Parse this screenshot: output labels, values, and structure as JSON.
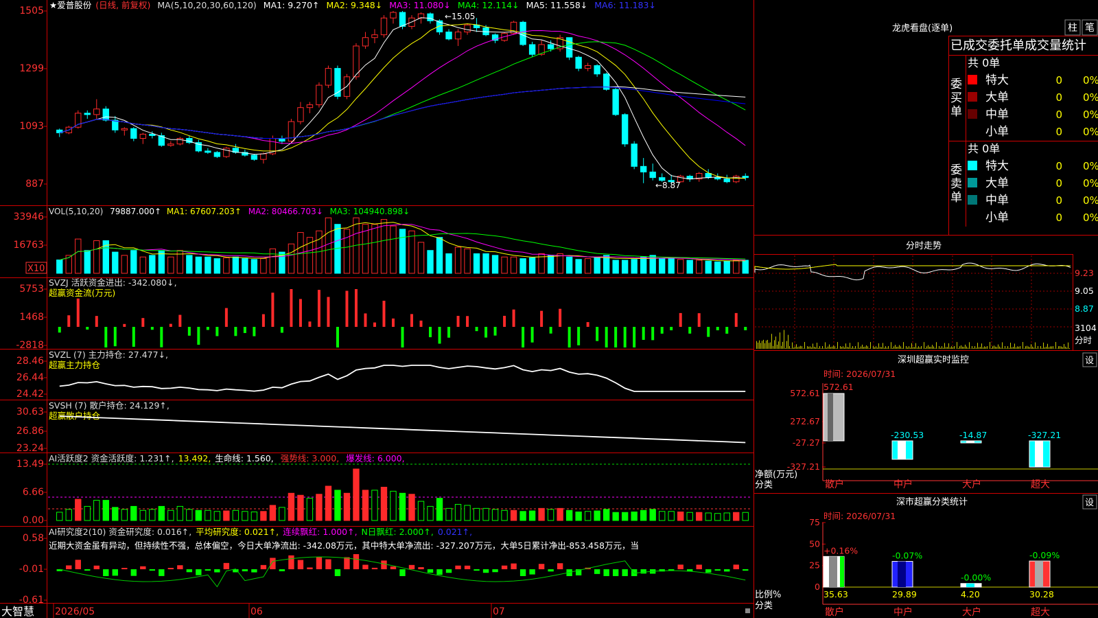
{
  "colors": {
    "up": "#ff2a2a",
    "down": "#00ffff",
    "grid": "#d00000",
    "bg": "#000000",
    "ma1": "#ffffff",
    "ma2": "#ffff00",
    "ma3": "#ff00ff",
    "ma4": "#00ff00",
    "ma5": "#ffffff",
    "ma6": "#0000ff",
    "label_red": "#ff3333",
    "label_yellow": "#ffff00"
  },
  "price_panel": {
    "stock_name": "★爱普股份",
    "period_note": "(日线, 前复权)",
    "ma_params": "MA(5,10,20,30,60,120)",
    "ma1": "MA1: 9.270↑",
    "ma2": "MA2: 9.348↓",
    "ma3": "MA3: 11.080↓",
    "ma4": "MA4: 12.114↓",
    "ma5": "MA5: 11.558↓",
    "ma6": "MA6: 11.183↓",
    "high_mark": "←15.05",
    "low_mark": "←8.87",
    "y_ticks": [
      "1505",
      "1299",
      "1093",
      "887"
    ]
  },
  "vol_panel": {
    "title": "VOL(5,10,20)",
    "value": "79887.000↑",
    "ma1": "MA1: 67607.203↑",
    "ma2": "MA2: 80466.703↓",
    "ma3": "MA3: 104940.898↓",
    "y_ticks": [
      "33946",
      "16763"
    ],
    "unit": "X10"
  },
  "svzj_panel": {
    "title": "SVZJ  活跃资金进出: -342.080↓,",
    "subtitle": "超赢资金流(万元)",
    "y_ticks": [
      "5753",
      "1468",
      "-2818"
    ]
  },
  "svzl_panel": {
    "title": "SVZL (7) 主力持仓: 27.477↓,",
    "subtitle": "超赢主力持仓",
    "y_ticks": [
      "28.46",
      "26.44",
      "24.42"
    ]
  },
  "svsh_panel": {
    "title": "SVSH (7) 散户持仓: 24.129↑,",
    "subtitle": "超赢散户持仓",
    "y_ticks": [
      "30.63",
      "26.86",
      "23.24"
    ]
  },
  "ai_panel": {
    "title": "AI活跃度2 资金活跃度: 1.231↑,",
    "v2": "13.492,",
    "v3": "生命线: 1.560,",
    "v4": "强势线: 3.000,",
    "v5": "爆发线: 6.000,",
    "y_ticks": [
      "13.49",
      "6.66",
      "0.00"
    ]
  },
  "research_panel": {
    "title": "AI研究度2(10) 资金研究度: 0.016↑,",
    "v2": "平均研究度: 0.021↑,",
    "v3": "连续飘红: 1.000↑,",
    "v4": "N日飘红: 2.000↑,",
    "v5": "0.021↑,",
    "comment": "近期大资金虽有异动，但持续性不强，总体偏空，今日大单净流出: -342.08万元，其中特大单净流出: -327.207万元，大单5日累计净出-853.458万元，当",
    "y_ticks": [
      "0.58",
      "-0.01",
      "-0.61"
    ]
  },
  "xaxis": {
    "brand": "大智慧",
    "labels": [
      "2026/05",
      "06",
      "07"
    ]
  },
  "right": {
    "lhb_title": "龙虎看盘(逐单)",
    "btn_bar": "柱",
    "btn_pen": "笔",
    "section_title": "已成交委托单成交量统计",
    "buy_label": "委买单",
    "sell_label": "委卖单",
    "buy_total": "共 0单",
    "sell_total": "共 0单",
    "buy_rows": [
      {
        "name": "特大",
        "count": "0",
        "pct": "0%",
        "color": "#ff0000"
      },
      {
        "name": "大单",
        "count": "0",
        "pct": "0%",
        "color": "#990000"
      },
      {
        "name": "中单",
        "count": "0",
        "pct": "0%",
        "color": "#660000"
      },
      {
        "name": "小单",
        "count": "0",
        "pct": "0%",
        "color": "#000000"
      }
    ],
    "sell_rows": [
      {
        "name": "特大",
        "count": "0",
        "pct": "0%",
        "color": "#00ffff"
      },
      {
        "name": "大单",
        "count": "0",
        "pct": "0%",
        "color": "#009999"
      },
      {
        "name": "中单",
        "count": "0",
        "pct": "0%",
        "color": "#007777"
      },
      {
        "name": "小单",
        "count": "0",
        "pct": "0%",
        "color": "#000000"
      }
    ],
    "fs_title": "分时走势",
    "fs_ticks": [
      "9.23",
      "9.05",
      "8.87",
      "3104",
      "分时"
    ],
    "sz_title": "深圳超赢实时监控",
    "sz_set": "设",
    "sz_time": "时间: 2026/07/31",
    "sz_ticks": [
      "572.61",
      "272.67",
      "-27.27",
      "-327.21"
    ],
    "sz_ylabel1": "净额(万元)",
    "sz_ylabel2": "分类",
    "sz_bars": [
      {
        "cat": "散户",
        "label": "572.61",
        "value": 572.61
      },
      {
        "cat": "中户",
        "label": "-230.53",
        "value": -230.53
      },
      {
        "cat": "大户",
        "label": "-14.87",
        "value": -14.87
      },
      {
        "cat": "超大",
        "label": "-327.21",
        "value": -327.21
      }
    ],
    "ss_title": "深市超赢分类统计",
    "ss_set": "设",
    "ss_time": "时间: 2026/07/31",
    "ss_ticks": [
      "75",
      "50",
      "25",
      "0"
    ],
    "ss_ylabel1": "比例%",
    "ss_ylabel2": "分类",
    "ss_bars": [
      {
        "cat": "散户",
        "top": "+0.16%",
        "bottom": "35.63",
        "value": 35.63,
        "color": "#ffffff"
      },
      {
        "cat": "中户",
        "top": "-0.07%",
        "bottom": "29.89",
        "value": 29.89,
        "color": "#2222ff"
      },
      {
        "cat": "大户",
        "top": "-0.00%",
        "bottom": "4.20",
        "value": 4.2,
        "color": "#ffffff"
      },
      {
        "cat": "超大",
        "top": "-0.09%",
        "bottom": "30.28",
        "value": 30.28,
        "color": "#ff3333"
      }
    ]
  },
  "chart_data": {
    "type": "candlestick",
    "note": "daily OHLC approximated from screenshot, y in price units; volume in X10 units",
    "price_range": [
      8.6,
      15.3
    ],
    "candles": [
      [
        10.8,
        10.85,
        10.55,
        10.7
      ],
      [
        10.7,
        10.95,
        10.65,
        10.9
      ],
      [
        10.9,
        11.5,
        10.85,
        11.4
      ],
      [
        11.4,
        11.5,
        11.2,
        11.35
      ],
      [
        11.35,
        11.9,
        11.2,
        11.55
      ],
      [
        11.55,
        11.65,
        11.1,
        11.15
      ],
      [
        11.15,
        11.3,
        10.7,
        10.8
      ],
      [
        10.8,
        10.9,
        10.6,
        10.85
      ],
      [
        10.85,
        10.9,
        10.4,
        10.5
      ],
      [
        10.5,
        10.7,
        10.3,
        10.65
      ],
      [
        10.65,
        10.75,
        10.5,
        10.6
      ],
      [
        10.6,
        10.7,
        10.2,
        10.25
      ],
      [
        10.25,
        10.4,
        10.2,
        10.3
      ],
      [
        10.3,
        10.55,
        10.25,
        10.5
      ],
      [
        10.5,
        10.6,
        10.3,
        10.35
      ],
      [
        10.35,
        10.45,
        10.0,
        10.05
      ],
      [
        10.05,
        10.15,
        9.95,
        10.0
      ],
      [
        10.0,
        10.05,
        9.8,
        9.85
      ],
      [
        9.85,
        10.2,
        9.8,
        10.15
      ],
      [
        10.15,
        10.3,
        9.95,
        10.0
      ],
      [
        10.0,
        10.1,
        9.85,
        9.9
      ],
      [
        9.9,
        9.95,
        9.7,
        9.75
      ],
      [
        9.75,
        10.0,
        9.6,
        9.95
      ],
      [
        9.95,
        10.6,
        9.9,
        10.5
      ],
      [
        10.5,
        10.6,
        10.3,
        10.4
      ],
      [
        10.4,
        11.2,
        10.35,
        11.1
      ],
      [
        11.1,
        11.8,
        11.0,
        11.6
      ],
      [
        11.6,
        11.8,
        11.4,
        11.7
      ],
      [
        11.7,
        12.5,
        11.6,
        12.4
      ],
      [
        12.4,
        13.1,
        12.3,
        13.0
      ],
      [
        13.0,
        13.1,
        11.9,
        12.0
      ],
      [
        12.0,
        12.8,
        11.9,
        12.7
      ],
      [
        12.7,
        13.9,
        12.6,
        13.8
      ],
      [
        13.8,
        14.3,
        13.7,
        14.1
      ],
      [
        14.1,
        14.4,
        13.9,
        14.2
      ],
      [
        14.2,
        14.9,
        14.1,
        14.8
      ],
      [
        14.8,
        15.05,
        14.6,
        15.0
      ],
      [
        15.0,
        15.05,
        14.4,
        14.5
      ],
      [
        14.5,
        14.9,
        14.4,
        14.8
      ],
      [
        14.8,
        15.0,
        14.6,
        14.95
      ],
      [
        14.95,
        15.0,
        14.6,
        14.7
      ],
      [
        14.7,
        14.75,
        14.2,
        14.3
      ],
      [
        14.3,
        14.4,
        14.0,
        14.05
      ],
      [
        14.05,
        14.4,
        13.8,
        14.3
      ],
      [
        14.3,
        14.6,
        14.2,
        14.55
      ],
      [
        14.55,
        14.8,
        14.3,
        14.45
      ],
      [
        14.45,
        14.55,
        14.15,
        14.2
      ],
      [
        14.2,
        14.25,
        13.9,
        14.0
      ],
      [
        14.0,
        14.3,
        13.95,
        14.25
      ],
      [
        14.25,
        14.7,
        14.2,
        14.65
      ],
      [
        14.65,
        14.7,
        13.8,
        13.85
      ],
      [
        13.85,
        13.95,
        13.4,
        13.5
      ],
      [
        13.5,
        14.0,
        13.45,
        13.85
      ],
      [
        13.85,
        14.0,
        13.6,
        13.7
      ],
      [
        13.7,
        14.2,
        13.6,
        14.1
      ],
      [
        14.1,
        14.1,
        13.3,
        13.4
      ],
      [
        13.4,
        13.45,
        12.9,
        13.0
      ],
      [
        13.0,
        13.2,
        12.9,
        13.1
      ],
      [
        13.1,
        13.15,
        12.7,
        12.8
      ],
      [
        12.8,
        12.85,
        12.2,
        12.25
      ],
      [
        12.25,
        12.3,
        11.3,
        11.35
      ],
      [
        11.35,
        11.4,
        10.2,
        10.3
      ],
      [
        10.3,
        10.4,
        9.4,
        9.5
      ],
      [
        9.5,
        9.8,
        8.9,
        9.3
      ],
      [
        9.3,
        9.6,
        9.0,
        9.1
      ],
      [
        9.1,
        9.25,
        8.95,
        9.0
      ],
      [
        9.0,
        9.2,
        8.87,
        8.95
      ],
      [
        8.95,
        9.2,
        8.92,
        9.15
      ],
      [
        9.15,
        9.2,
        8.95,
        9.05
      ],
      [
        9.05,
        9.3,
        8.95,
        9.25
      ],
      [
        9.25,
        9.4,
        9.05,
        9.1
      ],
      [
        9.1,
        9.25,
        9.0,
        9.05
      ],
      [
        9.05,
        9.2,
        8.9,
        8.95
      ],
      [
        8.95,
        9.2,
        8.9,
        9.15
      ],
      [
        9.15,
        9.25,
        9.0,
        9.1
      ]
    ],
    "volume": [
      8200,
      11000,
      21000,
      14000,
      20000,
      20000,
      13000,
      11000,
      14000,
      10000,
      11000,
      14000,
      10000,
      14000,
      11000,
      10000,
      10000,
      9000,
      9500,
      10000,
      9000,
      8500,
      9000,
      15000,
      13000,
      18000,
      25000,
      22000,
      26000,
      34000,
      30000,
      27000,
      34000,
      30000,
      30000,
      33000,
      29000,
      27000,
      26000,
      19000,
      14000,
      22000,
      12000,
      16000,
      15000,
      12000,
      12000,
      11000,
      10000,
      10000,
      9000,
      9500,
      12000,
      11000,
      12000,
      10000,
      8500,
      9000,
      9500,
      11000,
      8000,
      8000,
      8500,
      10000,
      11000,
      9000,
      9000,
      8500,
      8000,
      8000,
      7500,
      7000,
      7500,
      8000,
      8000
    ]
  }
}
